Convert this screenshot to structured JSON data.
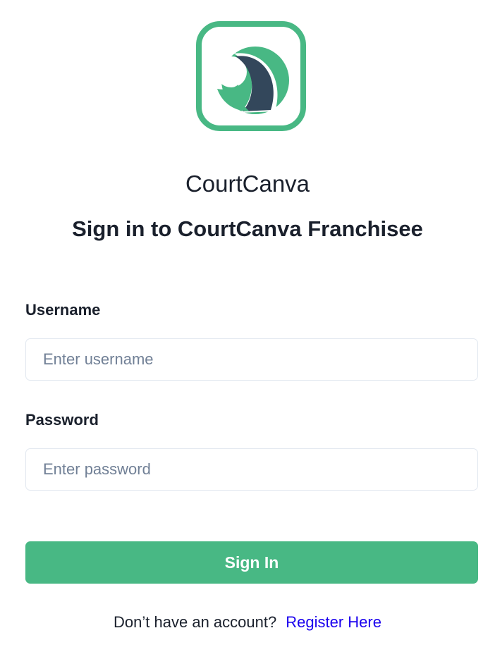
{
  "brand": {
    "app_name": "CourtCanva",
    "logo_icon": "courtcanva-logo-icon",
    "colors": {
      "primary_green": "#48b884",
      "dark_navy": "#33475b",
      "link_blue": "#1a00ee"
    }
  },
  "page": {
    "heading": "Sign in to CourtCanva Franchisee"
  },
  "form": {
    "username": {
      "label": "Username",
      "placeholder": "Enter username",
      "value": ""
    },
    "password": {
      "label": "Password",
      "placeholder": "Enter password",
      "value": ""
    },
    "submit_label": "Sign In"
  },
  "footer": {
    "prompt": "Don’t have an account?",
    "register_link": "Register Here"
  }
}
